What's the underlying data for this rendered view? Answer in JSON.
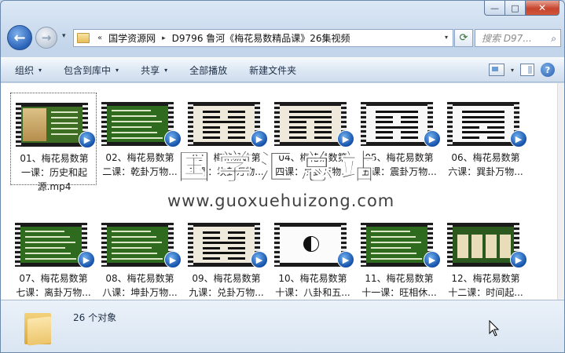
{
  "window": {
    "caption_buttons": {
      "minimize": "—",
      "maximize": "□",
      "close": "✕"
    }
  },
  "address": {
    "sep": "«",
    "crumbs": [
      "国学资源网",
      "D9796 鲁河《梅花易数精品课》26集视频"
    ],
    "arrow": "▸",
    "dropdown": "▾"
  },
  "nav": {
    "back": "←",
    "forward": "→",
    "history_dropdown": "▾",
    "refresh": "⟳"
  },
  "search": {
    "placeholder": "搜索 D97...",
    "icon": "⌕"
  },
  "toolbar": {
    "items": [
      {
        "label": "组织",
        "caret": "▾"
      },
      {
        "label": "包含到库中",
        "caret": "▾"
      },
      {
        "label": "共享",
        "caret": "▾"
      },
      {
        "label": "全部播放",
        "caret": ""
      },
      {
        "label": "新建文件夹",
        "caret": ""
      }
    ],
    "view_caret": "▾",
    "help": "?"
  },
  "files": [
    {
      "line1": "01、梅花易数第",
      "line2": "一课：历史和起",
      "line3": "源.mp4",
      "thumb": "portrait",
      "selected": true
    },
    {
      "line1": "02、梅花易数第",
      "line2": "二课：乾卦万物...",
      "line3": "",
      "thumb": "text",
      "selected": false
    },
    {
      "line1": "03、梅花易数第",
      "line2": "三课：坎卦万物...",
      "line3": "",
      "thumb": "kan",
      "selected": false
    },
    {
      "line1": "04、梅花易数第",
      "line2": "四课：艮卦万物...",
      "line3": "",
      "thumb": "gen",
      "selected": false
    },
    {
      "line1": "05、梅花易数第",
      "line2": "五课：震卦万物...",
      "line3": "",
      "thumb": "zhen",
      "selected": false
    },
    {
      "line1": "06、梅花易数第",
      "line2": "六课：巽卦万物...",
      "line3": "",
      "thumb": "xun",
      "selected": false
    },
    {
      "line1": "07、梅花易数第",
      "line2": "七课：离卦万物...",
      "line3": "",
      "thumb": "text",
      "selected": false
    },
    {
      "line1": "08、梅花易数第",
      "line2": "八课：坤卦万物...",
      "line3": "",
      "thumb": "text",
      "selected": false
    },
    {
      "line1": "09、梅花易数第",
      "line2": "九课：兑卦万物...",
      "line3": "",
      "thumb": "dui",
      "selected": false
    },
    {
      "line1": "10、梅花易数第",
      "line2": "十课：八卦和五...",
      "line3": "",
      "thumb": "bagua",
      "selected": false
    },
    {
      "line1": "11、梅花易数第",
      "line2": "十一课：旺相休...",
      "line3": "",
      "thumb": "text",
      "selected": false
    },
    {
      "line1": "12、梅花易数第",
      "line2": "十二课：时间起...",
      "line3": "",
      "thumb": "table",
      "selected": false
    }
  ],
  "media_badge_glyph": "▶",
  "watermark": {
    "cn": "国学汇总站",
    "url": "www.guoxuehuizong.com"
  },
  "status": {
    "count": "26 个对象"
  }
}
